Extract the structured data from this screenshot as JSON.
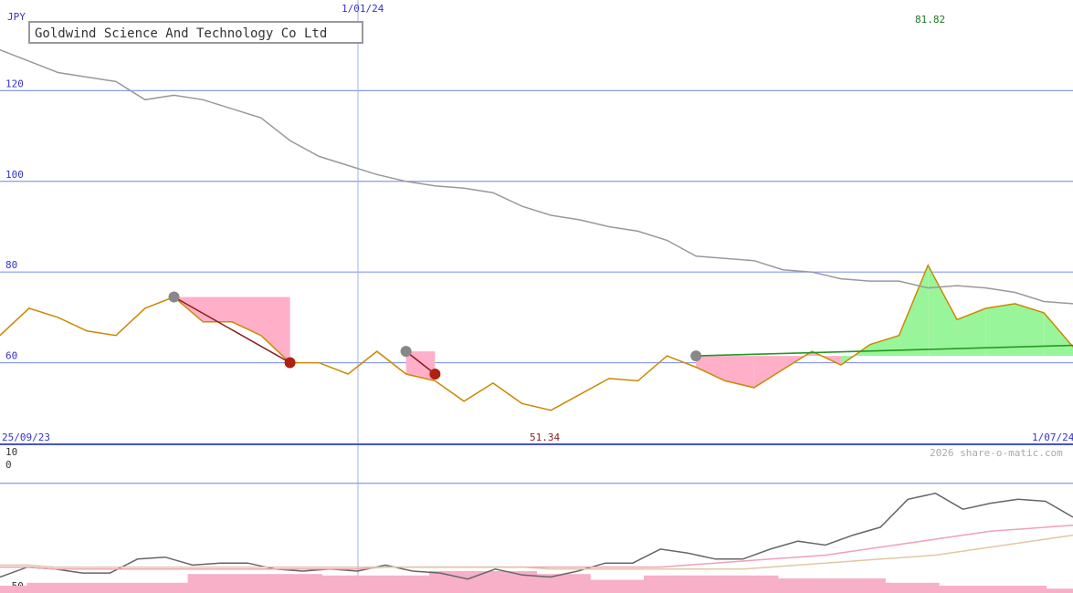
{
  "chart_data": {
    "type": "line",
    "title": "Goldwind Science And Technology Co Ltd",
    "currency": "JPY",
    "watermark": "2026 share-o-matic.com",
    "x_labels": {
      "start": "25/09/23",
      "mid": "1/01/24",
      "end": "1/07/24"
    },
    "annotations": {
      "high": "81.82",
      "low": "51.34"
    },
    "price_panel": {
      "ylim": [
        42,
        140
      ],
      "y_ticks": [
        60,
        80,
        100,
        120
      ],
      "series": [
        {
          "key": "price",
          "color": "#cc8800",
          "values": [
            66,
            72,
            70,
            67,
            66,
            72,
            74.5,
            69,
            69,
            66,
            60,
            60,
            57.5,
            62.5,
            57.5,
            56,
            51.5,
            55.5,
            51,
            49.5,
            53,
            56.5,
            56,
            61.5,
            59,
            56,
            54.5,
            58.5,
            62.5,
            59.5,
            64,
            66,
            81.5,
            69.5,
            72,
            73,
            71,
            63.5
          ]
        },
        {
          "key": "moving-average",
          "color": "#999999",
          "values": [
            129,
            126.5,
            124,
            123,
            122,
            118,
            119,
            118,
            116,
            114,
            109,
            105.5,
            103.5,
            101.5,
            100,
            99,
            98.5,
            97.5,
            94.5,
            92.5,
            91.5,
            90,
            89,
            87,
            83.5,
            83,
            82.5,
            80.5,
            80,
            78.5,
            78,
            78,
            76.5,
            77,
            76.5,
            75.5,
            73.5,
            73
          ]
        }
      ],
      "signals": [
        {
          "type": "sell",
          "from_index": 6,
          "to_index": 10,
          "from_value": 74.5,
          "to_value": 60
        },
        {
          "type": "sell",
          "from_index": 14,
          "to_index": 15,
          "from_value": 62.5,
          "to_value": 57.5
        },
        {
          "type": "buy",
          "from_index": 24,
          "to_index": 38,
          "from_value": 61.5,
          "to_value": 64
        }
      ]
    },
    "indicator_panel": {
      "ylim": [
        -55,
        15
      ],
      "y_ticks": [
        10,
        0,
        -50
      ],
      "series": [
        {
          "key": "momentum",
          "color": "#666666",
          "values": [
            -47,
            -42,
            -43,
            -45,
            -45,
            -38,
            -37,
            -41,
            -40,
            -40,
            -43,
            -44,
            -43,
            -44,
            -41,
            -44,
            -45,
            -48,
            -43,
            -46,
            -47,
            -44,
            -40,
            -40,
            -33,
            -35,
            -38,
            -38,
            -33,
            -29,
            -31,
            -26,
            -22,
            -8,
            -5,
            -13,
            -10,
            -8,
            -9,
            -17
          ]
        },
        {
          "key": "ma-fast",
          "color": "#f0a0b8",
          "values": [
            -42,
            -42,
            -43,
            -43,
            -43,
            -43,
            -43,
            -43,
            -43,
            -43,
            -43,
            -43,
            -43,
            -43,
            -42,
            -42,
            -42,
            -42,
            -42,
            -42,
            -42,
            -42,
            -42,
            -42,
            -42,
            -41,
            -40,
            -39,
            -38,
            -37,
            -36,
            -34,
            -32,
            -30,
            -28,
            -26,
            -24,
            -23,
            -22,
            -21
          ]
        },
        {
          "key": "ma-slow",
          "color": "#e0c8a0",
          "values": [
            -41,
            -41,
            -42,
            -42,
            -42,
            -42,
            -42,
            -42,
            -42,
            -42,
            -42,
            -42,
            -42,
            -42,
            -42,
            -42,
            -42,
            -42,
            -42,
            -42,
            -43,
            -43,
            -43,
            -43,
            -43,
            -43,
            -43,
            -43,
            -42,
            -41,
            -40,
            -39,
            -38,
            -37,
            -36,
            -34,
            -32,
            -30,
            -28,
            -26
          ]
        }
      ],
      "volume_bars": [
        20,
        28,
        28,
        28,
        28,
        28,
        28,
        52,
        52,
        52,
        52,
        52,
        48,
        48,
        48,
        48,
        60,
        60,
        60,
        60,
        52,
        52,
        36,
        36,
        48,
        48,
        48,
        48,
        48,
        40,
        40,
        40,
        40,
        28,
        28,
        20,
        20,
        20,
        20,
        12
      ]
    },
    "grid": true
  }
}
